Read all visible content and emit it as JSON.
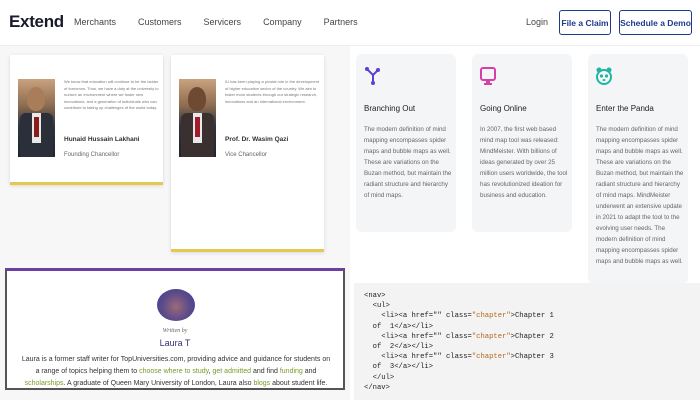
{
  "nav": {
    "logo": "Extend",
    "links": [
      "Merchants",
      "Customers",
      "Servicers",
      "Company",
      "Partners"
    ],
    "login": "Login",
    "file_claim": "File a Claim",
    "schedule_demo": "Schedule a Demo"
  },
  "cards": [
    {
      "text": "We know that education will continue to be the ladder of tomorrow. Thus, we have a duty at the university to nurture an environment where we foster new innovations, and a generation of individuals who can contribute to taking up challenges of the world today.",
      "name": "Hunaid Hussain Lakhani",
      "role": "Founding Chancellor"
    },
    {
      "text": "IU has been playing a pivotal role in the development of higher education sector of the country. We aim to foster more students through our strategic research, innovations and an international environment.",
      "name": "Prof. Dr. Wasim Qazi",
      "role": "Vice Chancellor"
    }
  ],
  "author": {
    "written_by": "Written by",
    "name": "Laura T",
    "bio_1": "Laura is a former staff writer for TopUniversities.com, providing advice and guidance for students on a range of topics helping them to ",
    "link_1": "choose where to study",
    "sep_1": ", ",
    "link_2": "get admitted",
    "bio_2": " and find ",
    "link_3": "funding",
    "sep_2": " and ",
    "link_4": "scholarships",
    "bio_3": ". A graduate of Queen Mary University of London, Laura also ",
    "link_5": "blogs",
    "bio_4": " about student life."
  },
  "features": [
    {
      "icon": "branch-icon",
      "title": "Branching Out",
      "desc": "The modern definition of mind mapping encompasses spider maps and bubble maps as well. These are variations on the Buzan method, but maintain the radiant structure and hierarchy of mind maps."
    },
    {
      "icon": "monitor-icon",
      "title": "Going Online",
      "desc": "In 2007, the first web based mind map tool was released: MindMeister. With billions of ideas generated by over 25 million users worldwide, the tool has revolutionized ideation for business and education."
    },
    {
      "icon": "panda-icon",
      "title": "Enter the Panda",
      "desc": "The modern definition of mind mapping encompasses spider maps and bubble maps as well. These are variations on the Buzan method, but maintain the radiant structure and hierarchy of mind maps. MindMeister underwent an extensive update in 2021 to adapt the tool to the evolving user needs. The modern definition of mind mapping encompasses spider maps and bubble maps as well."
    }
  ],
  "code": {
    "nav_open": "<nav>",
    "ul_open": "  <ul>",
    "li_prefix": "    <li><a href=\"\" class=",
    "class_val": "\"chapter\"",
    "chapters": [
      {
        "label": ">Chapter 1",
        "close": "  of  1</a></li>"
      },
      {
        "label": ">Chapter 2",
        "close": "  of  2</a></li>"
      },
      {
        "label": ">Chapter 3",
        "close": "  of  3</a></li>"
      }
    ],
    "ul_close": "  </ul>",
    "nav_close": "</nav>"
  },
  "colors": {
    "brand_blue": "#1e3a8a",
    "accent_gold": "#e5c850",
    "accent_purple": "#6b3fa0",
    "link_green": "#7a9a2a",
    "icon_purple": "#5b3fd6",
    "icon_pink": "#d63fa8",
    "icon_teal": "#1fb5a5"
  }
}
